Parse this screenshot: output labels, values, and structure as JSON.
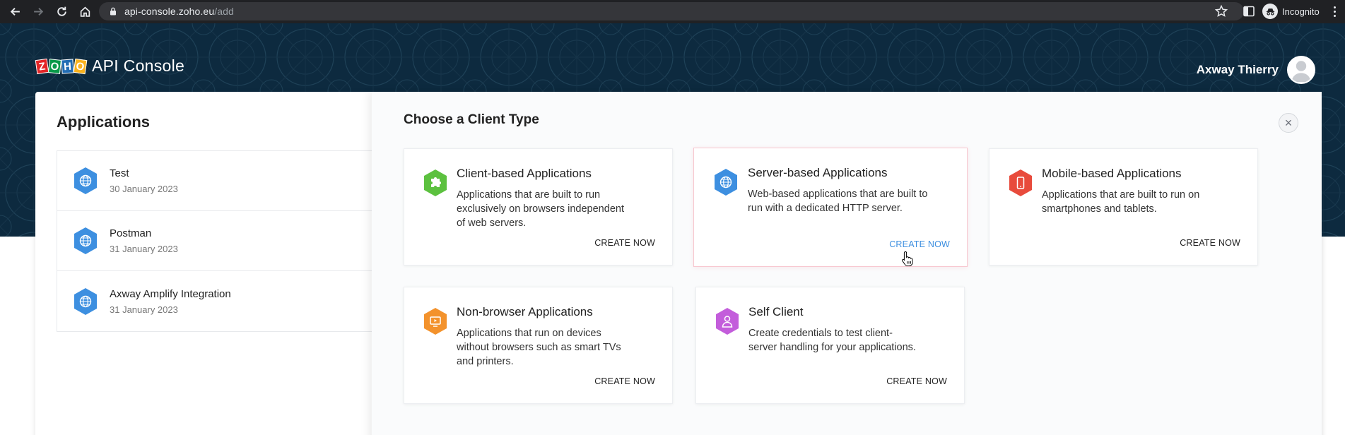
{
  "browser": {
    "url_domain": "api-console.zoho.eu",
    "url_path": "/add",
    "profile_label": "Incognito"
  },
  "header": {
    "brand_title": "API Console",
    "logo_letters": [
      "Z",
      "O",
      "H",
      "O"
    ],
    "user_name": "Axway Thierry"
  },
  "applications": {
    "heading": "Applications",
    "items": [
      {
        "name": "Test",
        "date": "30 January 2023"
      },
      {
        "name": "Postman",
        "date": "31 January 2023"
      },
      {
        "name": "Axway Amplify Integration",
        "date": "31 January 2023"
      }
    ]
  },
  "client_types": {
    "heading": "Choose a Client Type",
    "close_label": "×",
    "cards": [
      {
        "title": "Client-based Applications",
        "description": "Applications that are built to run exclusively on browsers independent of web servers.",
        "action": "CREATE NOW",
        "icon": "puzzle-icon",
        "color": "#5cc13f"
      },
      {
        "title": "Server-based Applications",
        "description": "Web-based applications that are built to run with a dedicated HTTP server.",
        "action": "CREATE NOW",
        "icon": "globe-icon",
        "color": "#3d8fe0"
      },
      {
        "title": "Mobile-based Applications",
        "description": "Applications that are built to run on smartphones and tablets.",
        "action": "CREATE NOW",
        "icon": "mobile-icon",
        "color": "#e84b3c"
      },
      {
        "title": "Non-browser Applications",
        "description": "Applications that run on devices without browsers such as smart TVs and printers.",
        "action": "CREATE NOW",
        "icon": "tv-icon",
        "color": "#f3922c"
      },
      {
        "title": "Self Client",
        "description": "Create credentials to test client-server handling for your applications.",
        "action": "CREATE NOW",
        "icon": "person-icon",
        "color": "#c35ddb"
      }
    ]
  },
  "colors": {
    "header_bg": "#0d2a3f",
    "app_icon": "#3d8fe0",
    "active_link": "#3d8fe0"
  }
}
